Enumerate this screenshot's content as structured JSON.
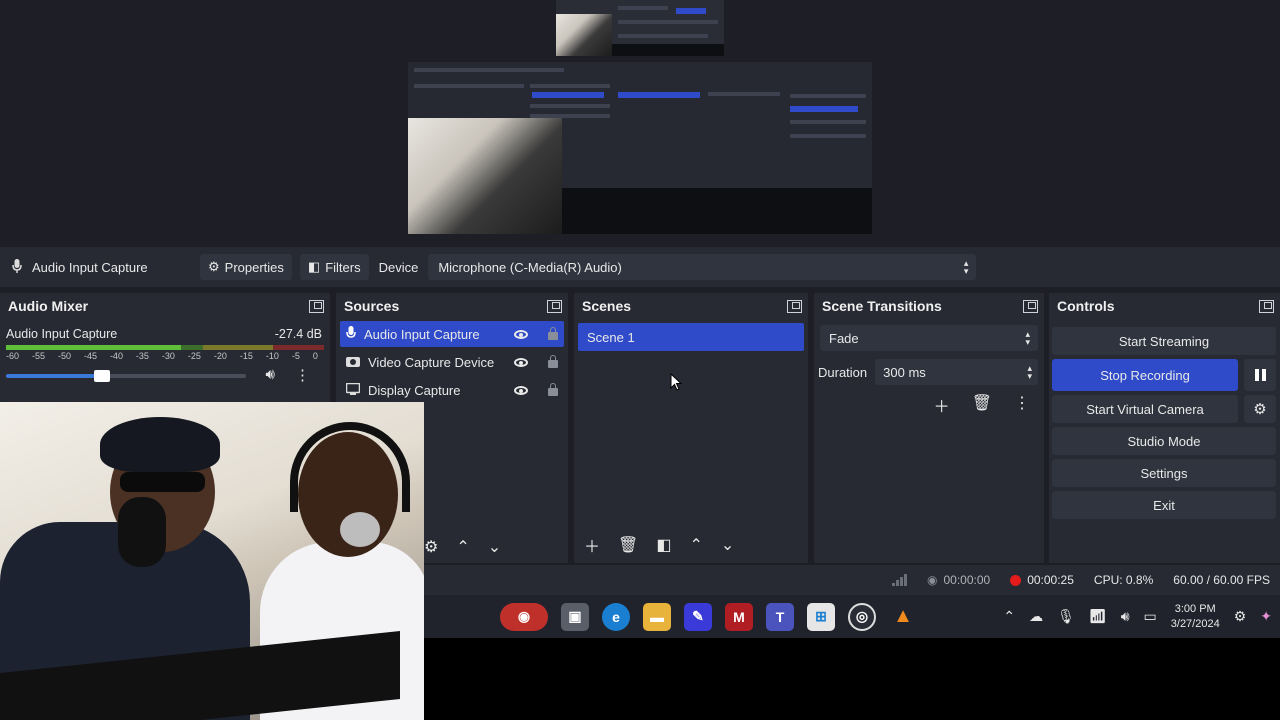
{
  "context_bar": {
    "source_name": "Audio Input Capture",
    "properties_label": "Properties",
    "filters_label": "Filters",
    "device_label": "Device",
    "device_value": "Microphone (C-Media(R) Audio)"
  },
  "mixer": {
    "title": "Audio Mixer",
    "channel_name": "Audio Input Capture",
    "channel_level": "-27.4 dB",
    "meter_level_fraction": 0.55,
    "volume_fraction": 0.4,
    "ticks": [
      "-60",
      "-55",
      "-50",
      "-45",
      "-40",
      "-35",
      "-30",
      "-25",
      "-20",
      "-15",
      "-10",
      "-5",
      "0"
    ]
  },
  "sources": {
    "title": "Sources",
    "items": [
      {
        "label": "Audio Input Capture",
        "icon": "microphone-icon",
        "selected": true
      },
      {
        "label": "Video Capture Device",
        "icon": "camera-icon",
        "selected": false
      },
      {
        "label": "Display Capture",
        "icon": "monitor-icon",
        "selected": false
      }
    ]
  },
  "scenes": {
    "title": "Scenes",
    "items": [
      {
        "label": "Scene 1",
        "selected": true
      }
    ]
  },
  "transitions": {
    "title": "Scene Transitions",
    "type": "Fade",
    "duration_label": "Duration",
    "duration_value": "300 ms"
  },
  "controls": {
    "title": "Controls",
    "start_streaming": "Start Streaming",
    "stop_recording": "Stop Recording",
    "start_virtual_camera": "Start Virtual Camera",
    "studio_mode": "Studio Mode",
    "settings": "Settings",
    "exit": "Exit"
  },
  "status": {
    "stream_time": "00:00:00",
    "record_time": "00:00:25",
    "cpu": "CPU: 0.8%",
    "fps": "60.00 / 60.00 FPS"
  },
  "taskbar": {
    "time": "3:00 PM",
    "date": "3/27/2024"
  },
  "colors": {
    "accent": "#2f4bc9",
    "panel": "#272a33",
    "record": "#e41b1b"
  }
}
